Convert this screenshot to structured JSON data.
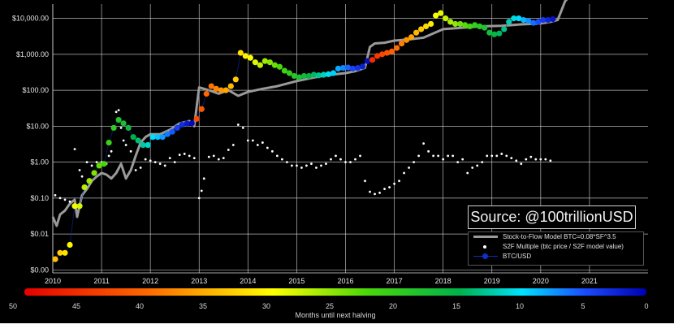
{
  "source_label": "Source: @100trillionUSD",
  "legend": {
    "s2f_model": "Stock-to-Flow Model BTC=0.08*SF^3.5",
    "s2f_multiple": "S2F Multiple (btc price / S2F model value)",
    "btc_usd": "BTC/USD"
  },
  "colorbar": {
    "label": "Months until next halving",
    "ticks": [
      "50",
      "45",
      "40",
      "35",
      "30",
      "25",
      "20",
      "15",
      "10",
      "5",
      "0"
    ]
  },
  "chart_data": {
    "type": "scatter",
    "yscale": "log",
    "xlim": [
      2010,
      2022.2
    ],
    "ylim": [
      0.00083,
      25000
    ],
    "x_ticks": [
      "2010",
      "2011",
      "2012",
      "2013",
      "2014",
      "2015",
      "2016",
      "2017",
      "2018",
      "2019",
      "2020",
      "2021"
    ],
    "y_ticks": [
      "$0.00",
      "$0.01",
      "$0.10",
      "$1.00",
      "$10.00",
      "$100.00",
      "$1,000.00",
      "$10,000.00"
    ],
    "y_tick_values": [
      0.001,
      0.01,
      0.1,
      1,
      10,
      100,
      1000,
      10000
    ],
    "grid": true,
    "legend_position": "bottom-right",
    "series": [
      {
        "name": "Stock-to-Flow Model BTC=0.08*SF^3.5",
        "color": "#9a9a9a",
        "x": [
          2010.0,
          2010.08,
          2010.15,
          2010.25,
          2010.35,
          2010.45,
          2010.5,
          2010.6,
          2010.7,
          2010.8,
          2010.9,
          2011.0,
          2011.1,
          2011.2,
          2011.3,
          2011.4,
          2011.5,
          2011.6,
          2011.7,
          2011.8,
          2011.9,
          2012.0,
          2012.2,
          2012.4,
          2012.6,
          2012.8,
          2012.9,
          2013.0,
          2013.2,
          2013.4,
          2013.6,
          2013.8,
          2014.0,
          2014.3,
          2014.6,
          2015.0,
          2015.3,
          2015.6,
          2016.0,
          2016.2,
          2016.4,
          2016.5,
          2016.6,
          2016.8,
          2017.0,
          2017.3,
          2017.6,
          2018.0,
          2018.4,
          2018.8,
          2019.2,
          2019.6,
          2020.0,
          2020.2,
          2020.35,
          2020.5,
          2020.6
        ],
        "y": [
          0.03,
          0.017,
          0.035,
          0.045,
          0.07,
          0.09,
          0.03,
          0.12,
          0.18,
          0.3,
          0.4,
          0.5,
          0.45,
          0.35,
          0.5,
          0.9,
          0.35,
          0.6,
          1.5,
          3.5,
          5,
          6,
          6,
          8,
          12,
          14,
          10,
          120,
          100,
          80,
          100,
          70,
          90,
          110,
          130,
          180,
          220,
          260,
          300,
          340,
          420,
          1600,
          2000,
          2100,
          2400,
          2600,
          2900,
          5000,
          5500,
          6000,
          6200,
          6800,
          7200,
          8000,
          9000,
          30000,
          90000
        ]
      },
      {
        "name": "S2F Multiple (btc price / S2F model value)",
        "color": "#ffffff",
        "x": [
          2010.05,
          2010.15,
          2010.25,
          2010.35,
          2010.45,
          2010.55,
          2010.6,
          2010.7,
          2010.8,
          2010.9,
          2011.0,
          2011.1,
          2011.15,
          2011.2,
          2011.3,
          2011.35,
          2011.4,
          2011.45,
          2011.5,
          2011.6,
          2011.7,
          2011.8,
          2011.9,
          2012.0,
          2012.1,
          2012.2,
          2012.3,
          2012.4,
          2012.5,
          2012.6,
          2012.7,
          2012.8,
          2012.9,
          2013.0,
          2013.05,
          2013.1,
          2013.2,
          2013.3,
          2013.4,
          2013.5,
          2013.6,
          2013.7,
          2013.8,
          2013.9,
          2014.0,
          2014.1,
          2014.2,
          2014.3,
          2014.4,
          2014.5,
          2014.6,
          2014.7,
          2014.8,
          2014.9,
          2015.0,
          2015.1,
          2015.2,
          2015.3,
          2015.4,
          2015.5,
          2015.6,
          2015.7,
          2015.8,
          2015.9,
          2016.0,
          2016.1,
          2016.2,
          2016.3,
          2016.4,
          2016.5,
          2016.6,
          2016.7,
          2016.8,
          2016.9,
          2017.0,
          2017.1,
          2017.2,
          2017.3,
          2017.4,
          2017.5,
          2017.6,
          2017.7,
          2017.8,
          2017.9,
          2018.0,
          2018.1,
          2018.2,
          2018.3,
          2018.4,
          2018.5,
          2018.6,
          2018.7,
          2018.8,
          2018.9,
          2019.0,
          2019.1,
          2019.2,
          2019.3,
          2019.4,
          2019.5,
          2019.6,
          2019.7,
          2019.8,
          2019.9,
          2020.0,
          2020.1,
          2020.2
        ],
        "y": [
          0.12,
          0.1,
          0.09,
          0.08,
          2.3,
          0.6,
          0.4,
          1.0,
          0.8,
          1.0,
          1.0,
          0.9,
          1.5,
          2.0,
          25,
          28,
          9,
          4,
          3,
          2,
          0.6,
          0.7,
          1.2,
          1.1,
          1.0,
          0.9,
          0.8,
          1.3,
          1.0,
          1.6,
          1.7,
          1.5,
          1.3,
          0.1,
          0.16,
          0.35,
          1.4,
          1.5,
          1.2,
          1.3,
          2.2,
          3.0,
          11,
          9,
          4,
          4,
          3,
          3.5,
          2.5,
          2.0,
          1.5,
          1.2,
          1.0,
          0.8,
          0.8,
          0.7,
          0.8,
          0.9,
          0.7,
          0.8,
          0.9,
          1.2,
          1.5,
          1.2,
          1.0,
          1.0,
          1.2,
          1.5,
          0.3,
          0.15,
          0.13,
          0.14,
          0.18,
          0.2,
          0.25,
          0.3,
          0.5,
          0.7,
          1.0,
          1.5,
          3.3,
          2.0,
          1.5,
          1.5,
          1.2,
          1.5,
          1.5,
          1.0,
          1.2,
          0.5,
          0.7,
          0.8,
          1.0,
          1.5,
          1.5,
          1.5,
          1.7,
          1.5,
          1.3,
          1.1,
          0.9,
          1.2,
          1.4,
          1.2,
          1.2,
          1.2,
          1.1
        ]
      },
      {
        "name": "BTC/USD",
        "color": "#1030c8",
        "x": [
          2010.05,
          2010.15,
          2010.25,
          2010.35,
          2010.45,
          2010.55,
          2010.65,
          2010.75,
          2010.85,
          2010.95,
          2011.05,
          2011.15,
          2011.25,
          2011.35,
          2011.45,
          2011.55,
          2011.65,
          2011.75,
          2011.85,
          2011.95,
          2012.05,
          2012.15,
          2012.25,
          2012.35,
          2012.45,
          2012.55,
          2012.65,
          2012.75,
          2012.85,
          2012.95,
          2013.05,
          2013.15,
          2013.25,
          2013.35,
          2013.45,
          2013.55,
          2013.65,
          2013.75,
          2013.85,
          2013.95,
          2014.05,
          2014.15,
          2014.25,
          2014.35,
          2014.45,
          2014.55,
          2014.65,
          2014.75,
          2014.85,
          2014.95,
          2015.05,
          2015.15,
          2015.25,
          2015.35,
          2015.45,
          2015.55,
          2015.65,
          2015.75,
          2015.85,
          2015.95,
          2016.05,
          2016.15,
          2016.25,
          2016.35,
          2016.45,
          2016.55,
          2016.65,
          2016.75,
          2016.85,
          2016.95,
          2017.05,
          2017.15,
          2017.25,
          2017.35,
          2017.45,
          2017.55,
          2017.65,
          2017.75,
          2017.85,
          2017.95,
          2018.05,
          2018.15,
          2018.25,
          2018.35,
          2018.45,
          2018.55,
          2018.65,
          2018.75,
          2018.85,
          2018.95,
          2019.05,
          2019.15,
          2019.25,
          2019.35,
          2019.45,
          2019.55,
          2019.65,
          2019.75,
          2019.85,
          2019.95,
          2020.05,
          2020.15,
          2020.25
        ],
        "y": [
          0.002,
          0.003,
          0.003,
          0.005,
          0.06,
          0.06,
          0.2,
          0.3,
          0.5,
          0.8,
          0.9,
          3.5,
          9,
          15,
          12,
          9,
          5,
          4,
          3,
          3,
          5,
          5,
          5,
          6,
          7,
          9,
          11,
          12,
          12,
          16,
          30,
          80,
          130,
          110,
          100,
          100,
          130,
          200,
          1100,
          900,
          800,
          600,
          500,
          650,
          600,
          500,
          450,
          350,
          300,
          250,
          230,
          250,
          250,
          270,
          260,
          270,
          280,
          300,
          400,
          420,
          430,
          400,
          420,
          460,
          650,
          700,
          900,
          1000,
          1100,
          1200,
          1500,
          2000,
          2500,
          3000,
          4000,
          5000,
          6000,
          7000,
          12000,
          14000,
          10000,
          8000,
          7000,
          7000,
          6500,
          6000,
          6500,
          6000,
          5500,
          4000,
          3600,
          3800,
          5000,
          8000,
          10000,
          10000,
          9000,
          8500,
          7500,
          8000,
          9000,
          9000,
          9500
        ]
      }
    ],
    "halving_months": [
      50,
      45,
      40,
      35,
      30,
      25,
      20,
      15,
      10,
      5,
      0
    ]
  }
}
